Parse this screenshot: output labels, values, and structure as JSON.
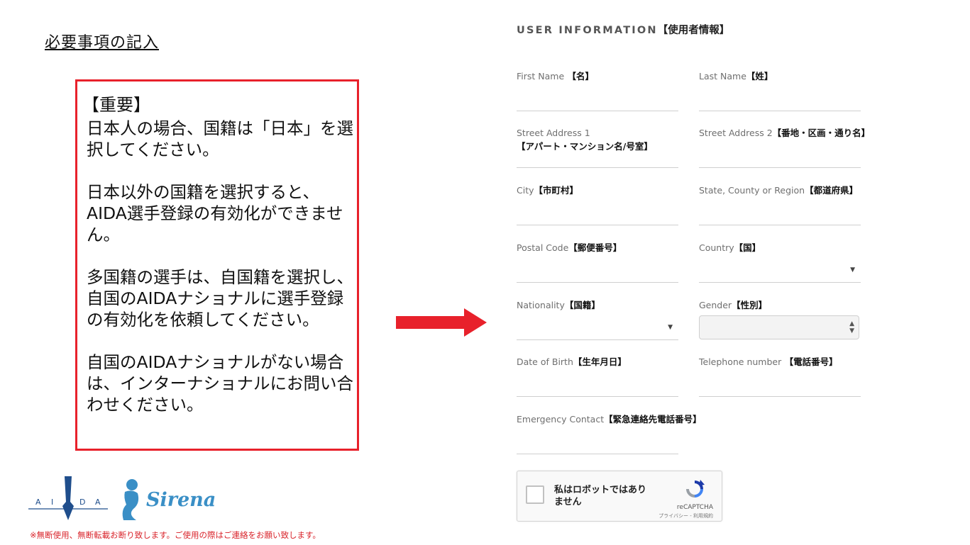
{
  "left": {
    "title": "必要事項の記入",
    "notice": {
      "heading": "【重要】",
      "paragraphs": [
        "日本人の場合、国籍は「日本」を選択してください。",
        "日本以外の国籍を選択すると、AIDA選手登録の有効化ができません。",
        "多国籍の選手は、自国籍を選択し、自国のAIDAナショナルに選手登録の有効化を依頼してください。",
        "自国のAIDAナショナルがない場合は、インターナショナルにお問い合わせください。"
      ]
    },
    "logos": {
      "aida_letters": [
        "A",
        "I",
        "D",
        "A"
      ],
      "sirena": "Sirena"
    },
    "copyright_note": "※無断使用、無断転載お断り致します。ご使用の際はご連絡をお願い致します。"
  },
  "form": {
    "section_title": "USER INFORMATION",
    "section_title_jp": "【使用者情報】",
    "fields": {
      "first_name": {
        "label": "First Name",
        "jp": " 【名】"
      },
      "last_name": {
        "label": "Last Name",
        "jp": "【姓】"
      },
      "street1": {
        "label": "Street Address 1",
        "jp": "【アパート・マンション名/号室】"
      },
      "street2": {
        "label": "Street Address 2",
        "jp": "【番地・区画・通り名】"
      },
      "city": {
        "label": "City",
        "jp": "【市町村】"
      },
      "state": {
        "label": "State, County or Region",
        "jp": "【都道府県】"
      },
      "postal": {
        "label": "Postal Code",
        "jp": "【郵便番号】"
      },
      "country": {
        "label": "Country",
        "jp": "【国】"
      },
      "nationality": {
        "label": "Nationality",
        "jp": "【国籍】"
      },
      "gender": {
        "label": "Gender",
        "jp": "【性別】"
      },
      "dob": {
        "label": "Date of Birth",
        "jp": "【生年月日】"
      },
      "phone": {
        "label": "Telephone number",
        "jp": " 【電話番号】"
      },
      "emergency": {
        "label": "Emergency Contact",
        "jp": "【緊急連絡先電話番号】"
      }
    },
    "recaptcha": {
      "label": "私はロボットではありません",
      "brand": "reCAPTCHA",
      "links": "プライバシー - 利用規約"
    }
  },
  "colors": {
    "red": "#e8212b",
    "aida_blue": "#1f4e8c",
    "sirena_blue": "#3a8fc6"
  }
}
